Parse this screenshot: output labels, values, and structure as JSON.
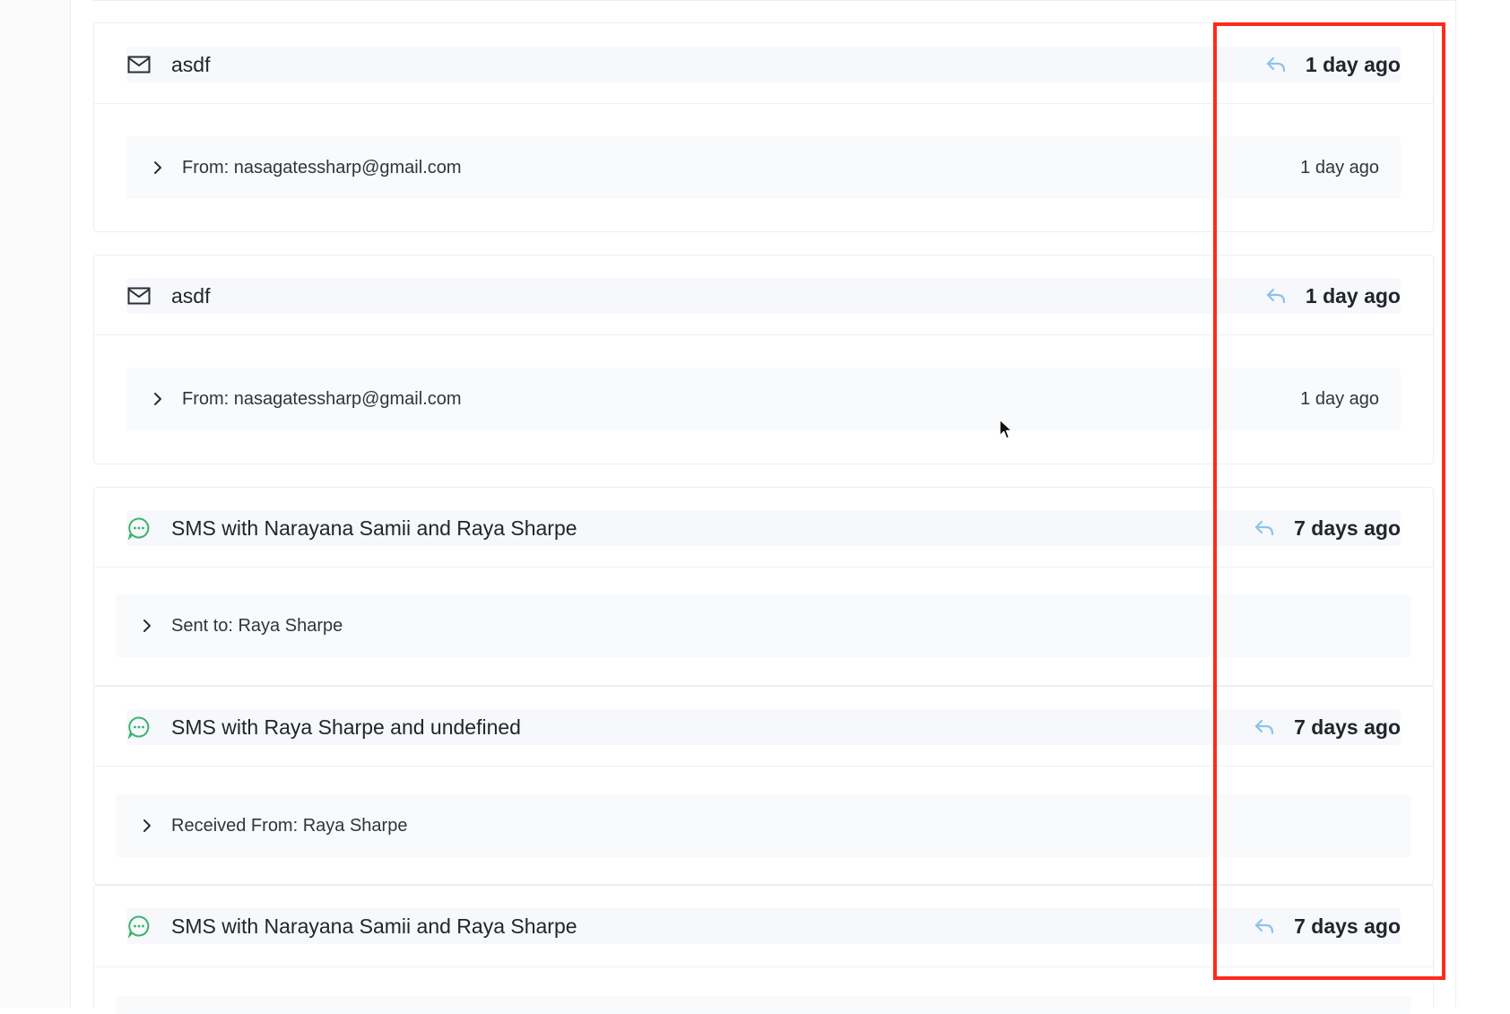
{
  "items": [
    {
      "kind": "email",
      "icon": "envelope-icon",
      "title": "asdf",
      "time": "1 day ago",
      "sub": {
        "label": "From: nasagatessharp@gmail.com",
        "time": "1 day ago"
      }
    },
    {
      "kind": "email",
      "icon": "envelope-icon",
      "title": "asdf",
      "time": "1 day ago",
      "sub": {
        "label": "From: nasagatessharp@gmail.com",
        "time": "1 day ago"
      }
    },
    {
      "kind": "sms",
      "icon": "chat-bubble-icon",
      "title": "SMS with Narayana Samii and Raya Sharpe",
      "time": "7 days ago",
      "sub": {
        "label": "Sent to: Raya Sharpe"
      }
    },
    {
      "kind": "sms",
      "icon": "chat-bubble-icon",
      "title": "SMS with Raya Sharpe and undefined",
      "time": "7 days ago",
      "sub": {
        "label": "Received From: Raya Sharpe"
      }
    },
    {
      "kind": "sms",
      "icon": "chat-bubble-icon",
      "title": "SMS with Narayana Samii and Raya Sharpe",
      "time": "7 days ago"
    }
  ],
  "colors": {
    "highlight": "#ff2a1a",
    "sms_icon": "#39b36a",
    "reply_icon": "#8cc3ea",
    "header_bg": "#f6f8fc"
  }
}
